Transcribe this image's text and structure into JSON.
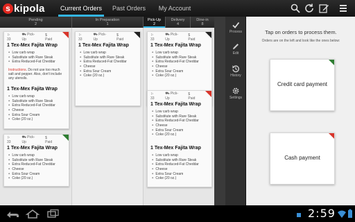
{
  "app": {
    "logo_letter": "s",
    "logo_rest": "kipola"
  },
  "tabs": [
    {
      "label": "Current Orders",
      "active": true
    },
    {
      "label": "Past Orders",
      "active": false
    },
    {
      "label": "My Account",
      "active": false
    }
  ],
  "toolbar_icons": [
    "search-icon",
    "refresh-icon",
    "edit-icon",
    "menu-icon"
  ],
  "columns": [
    {
      "title": "Pending",
      "count": "2"
    },
    {
      "title": "In Preparation",
      "count": "1"
    },
    {
      "title": "Pick-Up",
      "count": "2",
      "active": true
    },
    {
      "title": "Delivery",
      "count": "4"
    },
    {
      "title": "Dine-in",
      "count": "8"
    }
  ],
  "order_template": {
    "number": "33",
    "service": "Pick-Up",
    "payment": "Paid",
    "item": "1 Tex-Mex Fajita Wrap",
    "modifiers": [
      "Low carb wrap",
      "Substitute with Rare Steak",
      "Extra Reduced-Fat Cheddar",
      "Cheese",
      "Extra Sour Cream",
      "Coke (20 oz.)"
    ],
    "instructions_label": "Instructions",
    "instructions_text": ". Do not use too much salt and pepper. Also, don't include any utensils."
  },
  "status_colors": {
    "red": "#d8342a",
    "green": "#2e7d32",
    "black": "#222222",
    "accent": "#33b5e5"
  },
  "side_actions": [
    {
      "label": "Process",
      "icon": "checkmark-icon"
    },
    {
      "label": "Edit",
      "icon": "pencil-icon"
    },
    {
      "label": "History",
      "icon": "history-icon"
    },
    {
      "label": "Settings",
      "icon": "gear-icon"
    }
  ],
  "detail": {
    "title": "Tap on orders to process them.",
    "subtitle": "Orders are on the left and look like the ones below:",
    "credit_card_label": "Credit card payment",
    "cash_label": "Cash payment"
  },
  "system_bar": {
    "time": "2:59",
    "nav_icons": [
      "back-icon",
      "home-icon",
      "recent-apps-icon"
    ]
  }
}
